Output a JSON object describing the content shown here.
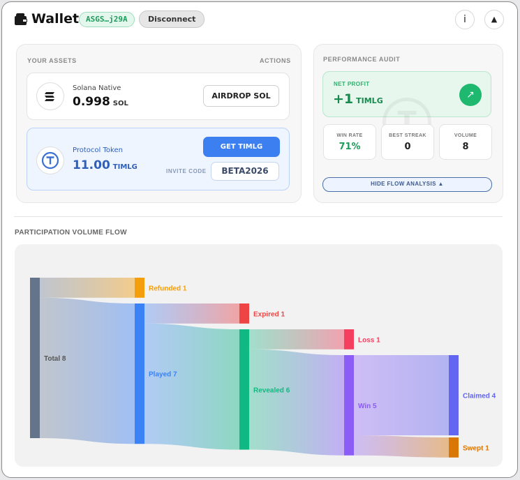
{
  "header": {
    "title": "Wallet",
    "address": "ASGS…j29A",
    "disconnect_label": "Disconnect",
    "info_label": "i",
    "collapse_label": "▲"
  },
  "assets": {
    "section_label": "YOUR ASSETS",
    "actions_label": "ACTIONS",
    "sol": {
      "name": "Solana Native",
      "amount": "0.998",
      "unit": "SOL",
      "button_label": "AIRDROP SOL"
    },
    "timlg": {
      "name": "Protocol Token",
      "amount": "11.00",
      "unit": "TIMLG",
      "button_label": "GET TIMLG",
      "invite_label": "INVITE CODE",
      "invite_code": "BETA2026"
    }
  },
  "performance": {
    "section_label": "PERFORMANCE AUDIT",
    "net_profit_label": "NET PROFIT",
    "net_profit_value": "+1",
    "net_profit_unit": "TIMLG",
    "stats": [
      {
        "label": "WIN RATE",
        "value": "71%"
      },
      {
        "label": "BEST STREAK",
        "value": "0"
      },
      {
        "label": "VOLUME",
        "value": "8"
      }
    ],
    "toggle_label": "HIDE FLOW ANALYSIS ▲"
  },
  "flow": {
    "title": "PARTICIPATION VOLUME FLOW"
  },
  "chart_data": {
    "type": "sankey",
    "nodes": [
      {
        "id": "total",
        "label": "Total 8",
        "value": 8,
        "color": "#64748b"
      },
      {
        "id": "refunded",
        "label": "Refunded 1",
        "value": 1,
        "color": "#f59e0b"
      },
      {
        "id": "played",
        "label": "Played 7",
        "value": 7,
        "color": "#3b82f6"
      },
      {
        "id": "expired",
        "label": "Expired 1",
        "value": 1,
        "color": "#ef4444"
      },
      {
        "id": "revealed",
        "label": "Revealed 6",
        "value": 6,
        "color": "#10b981"
      },
      {
        "id": "loss",
        "label": "Loss 1",
        "value": 1,
        "color": "#f43f5e"
      },
      {
        "id": "win",
        "label": "Win 5",
        "value": 5,
        "color": "#8b5cf6"
      },
      {
        "id": "claimed",
        "label": "Claimed 4",
        "value": 4,
        "color": "#6366f1"
      },
      {
        "id": "swept",
        "label": "Swept 1",
        "value": 1,
        "color": "#d97706"
      }
    ],
    "links": [
      {
        "source": "total",
        "target": "refunded",
        "value": 1
      },
      {
        "source": "total",
        "target": "played",
        "value": 7
      },
      {
        "source": "played",
        "target": "expired",
        "value": 1
      },
      {
        "source": "played",
        "target": "revealed",
        "value": 6
      },
      {
        "source": "revealed",
        "target": "loss",
        "value": 1
      },
      {
        "source": "revealed",
        "target": "win",
        "value": 5
      },
      {
        "source": "win",
        "target": "claimed",
        "value": 4
      },
      {
        "source": "win",
        "target": "swept",
        "value": 1
      }
    ]
  }
}
